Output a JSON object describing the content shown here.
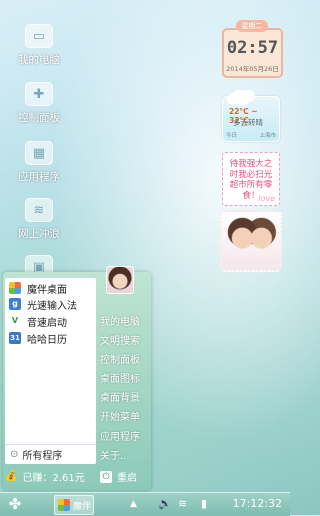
{
  "desktop_icons": [
    {
      "label": "我的电脑",
      "icon": "computer-icon",
      "glyph": "▭"
    },
    {
      "label": "控制面板",
      "icon": "control-panel-icon",
      "glyph": "✚"
    },
    {
      "label": "应用程序",
      "icon": "apps-icon",
      "glyph": "▦"
    },
    {
      "label": "网上冲浪",
      "icon": "browser-icon",
      "glyph": "≋"
    },
    {
      "label": "",
      "icon": "folder-icon",
      "glyph": "▣"
    }
  ],
  "clock_widget": {
    "weekday": "星期二",
    "time": "02:57",
    "date": "2014年05月26日"
  },
  "weather_widget": {
    "temp": "22°C ~ 32°C",
    "desc": "多云转晴",
    "today": "今日",
    "city": "上海市"
  },
  "note_widget": {
    "text": "待我强大之时我必扫光超市所有零食！",
    "love": "love"
  },
  "start_menu": {
    "apps": [
      {
        "label": "魔伴桌面",
        "icon": "mobanzhuomian-icon",
        "glyph": "✿",
        "color": "#f26b3a"
      },
      {
        "label": "光速输入法",
        "icon": "input-method-icon",
        "glyph": "g",
        "color": "#3d7fd6"
      },
      {
        "label": "音速启动",
        "icon": "launcher-icon",
        "glyph": "V",
        "color": "#2f9a4d"
      },
      {
        "label": "哈哈日历",
        "icon": "calendar-icon",
        "glyph": "31",
        "color": "#3a78c8"
      }
    ],
    "all_programs": "所有程序",
    "system_links": [
      "我的电脑",
      "文明搜索",
      "控制面板",
      "桌面图标",
      "桌面背景",
      "开始菜单",
      "应用程序",
      "关于.."
    ],
    "earned": "已赚：2.61元",
    "restart": "重启"
  },
  "taskbar": {
    "active_app": "魔伴",
    "tray_up": "▲",
    "tray_volume": "🔈",
    "tray_wifi": "≋",
    "tray_battery": "▮",
    "time": "17:12:32"
  }
}
